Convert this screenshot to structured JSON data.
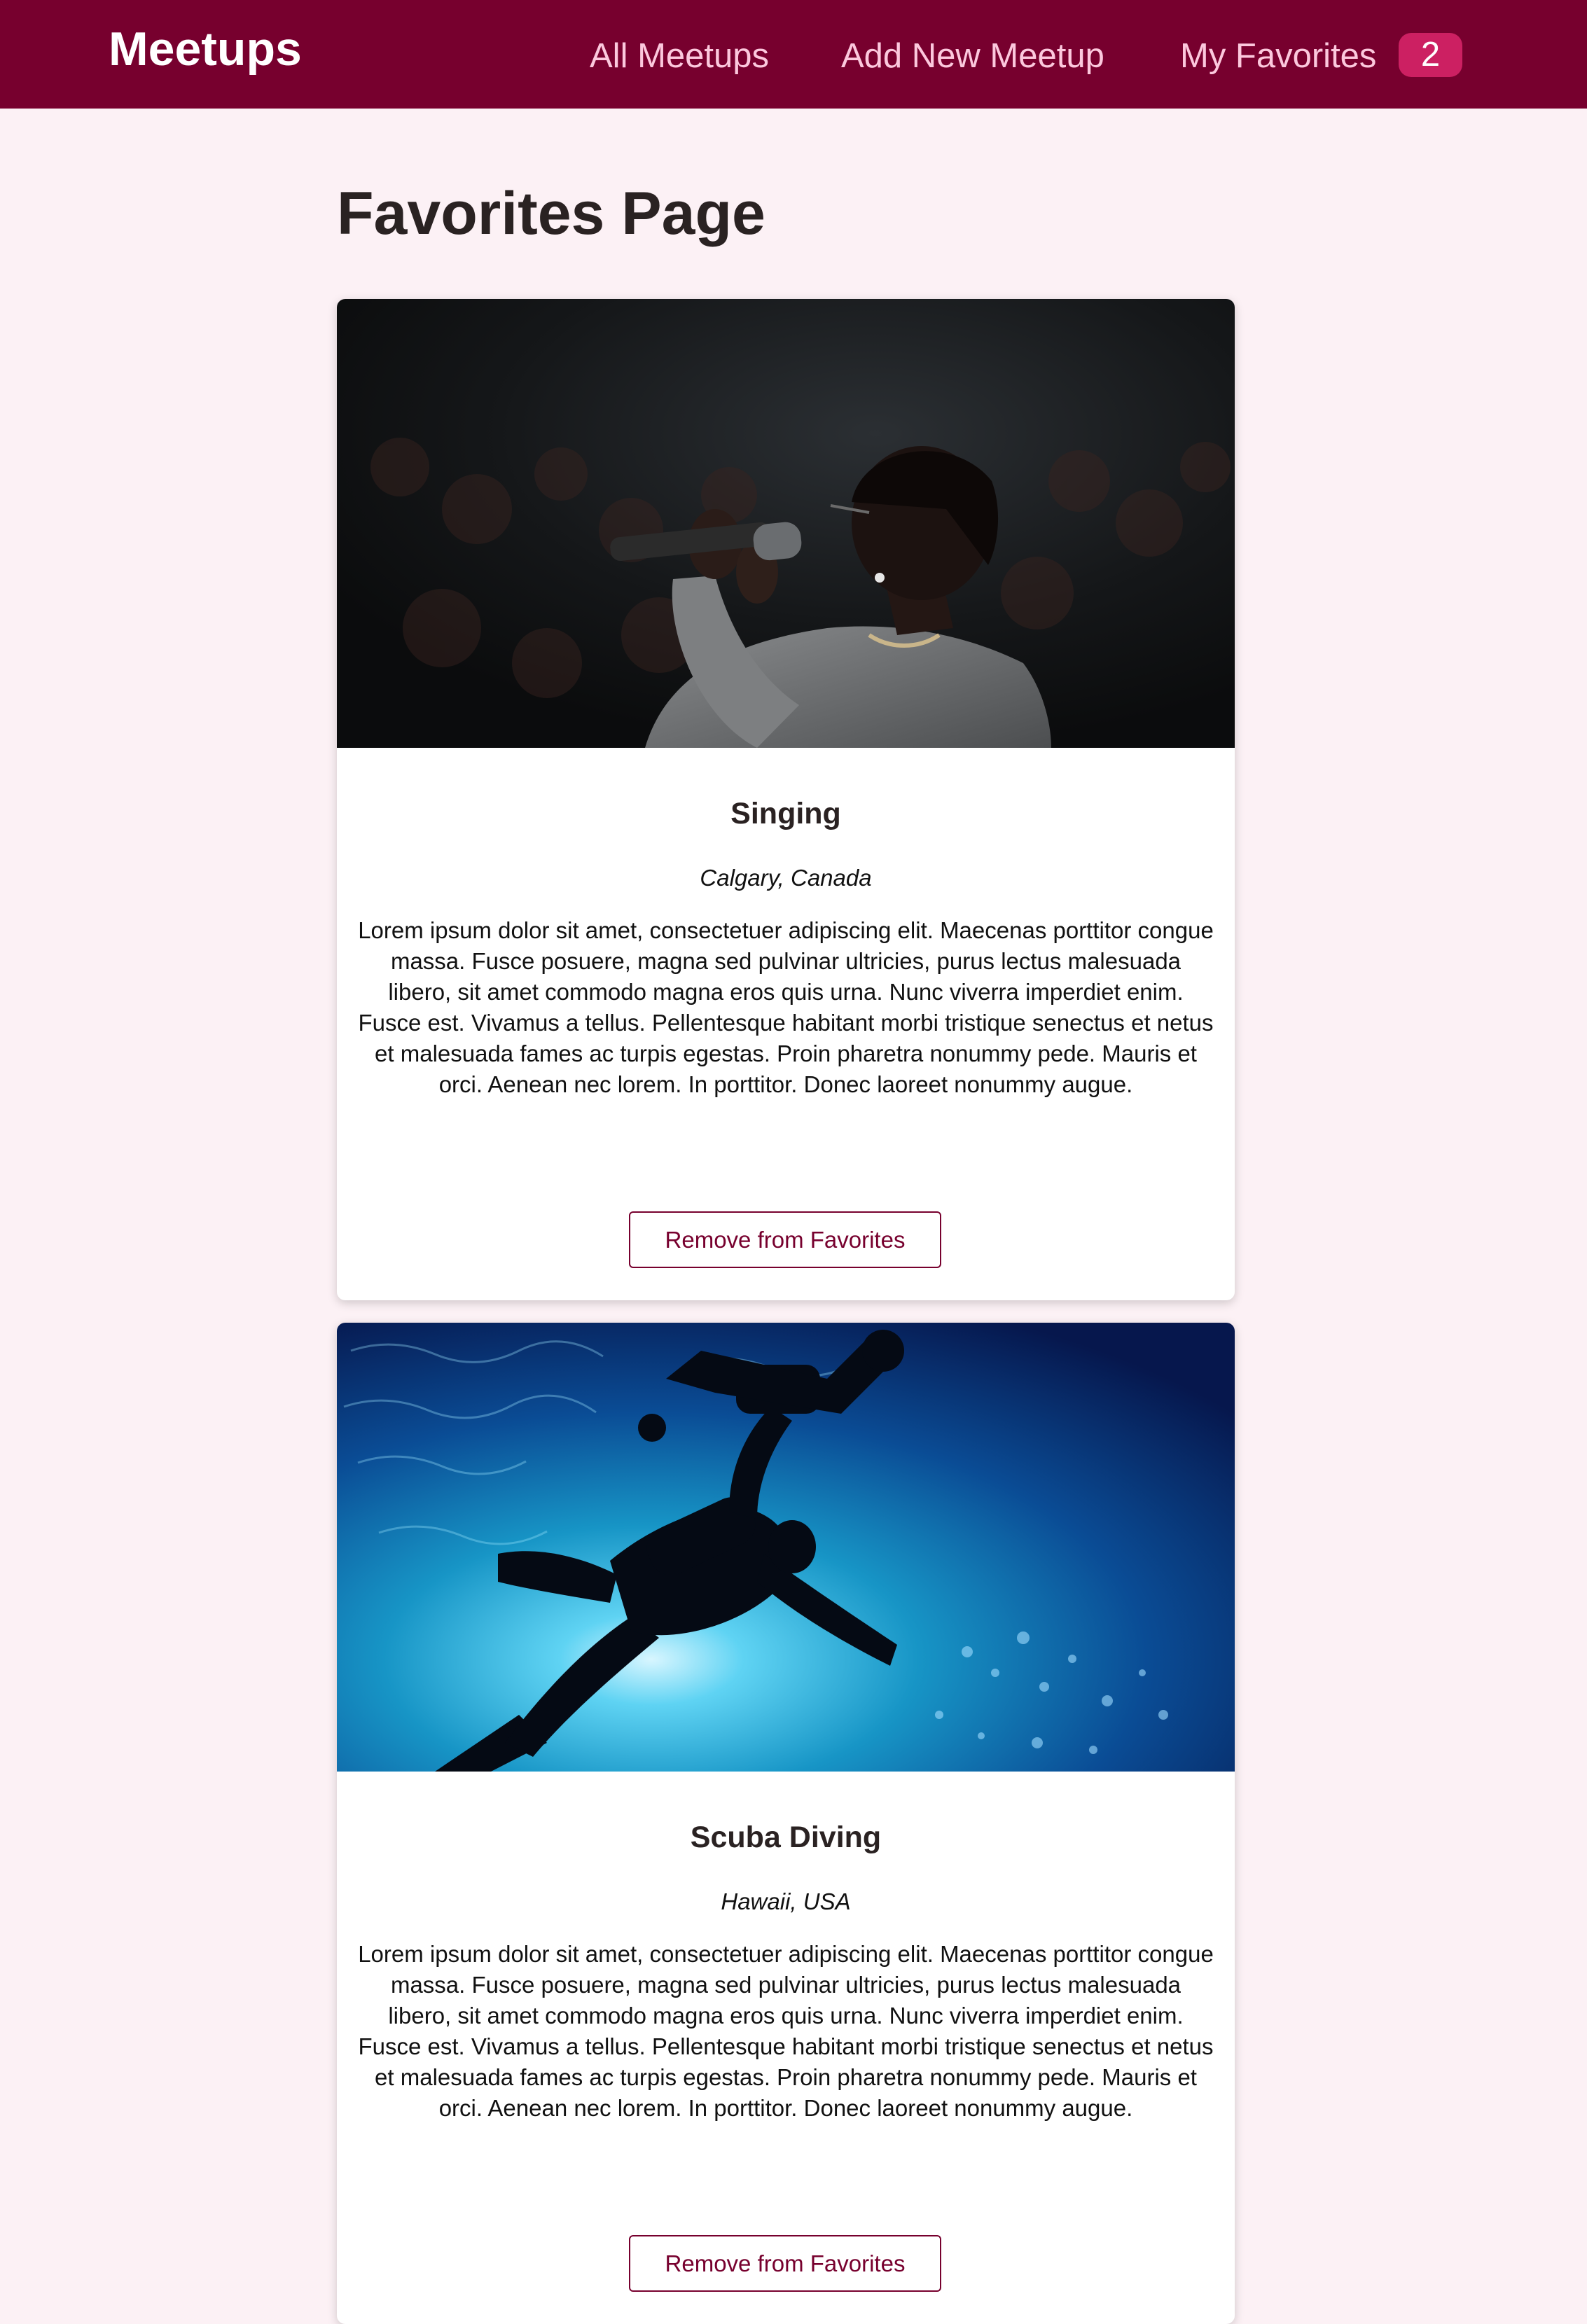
{
  "header": {
    "logo": "Meetups",
    "nav": {
      "all_meetups": "All Meetups",
      "add_new_meetup": "Add New Meetup",
      "my_favorites": "My Favorites",
      "favorites_count": "2"
    }
  },
  "main": {
    "title": "Favorites Page",
    "meetups": [
      {
        "title": "Singing",
        "location": "Calgary, Canada",
        "description": "Lorem ipsum dolor sit amet, consectetuer adipiscing elit. Maecenas porttitor congue massa. Fusce posuere, magna sed pulvinar ultricies, purus lectus malesuada libero, sit amet commodo magna eros quis urna. Nunc viverra imperdiet enim. Fusce est. Vivamus a tellus. Pellentesque habitant morbi tristique senectus et netus et malesuada fames ac turpis egestas. Proin pharetra nonummy pede. Mauris et orci. Aenean nec lorem. In porttitor. Donec laoreet nonummy augue.",
        "button_label": "Remove from Favorites"
      },
      {
        "title": "Scuba Diving",
        "location": "Hawaii, USA",
        "description": "Lorem ipsum dolor sit amet, consectetuer adipiscing elit. Maecenas porttitor congue massa. Fusce posuere, magna sed pulvinar ultricies, purus lectus malesuada libero, sit amet commodo magna eros quis urna. Nunc viverra imperdiet enim. Fusce est. Vivamus a tellus. Pellentesque habitant morbi tristique senectus et netus et malesuada fames ac turpis egestas. Proin pharetra nonummy pede. Mauris et orci. Aenean nec lorem. In porttitor. Donec laoreet nonummy augue.",
        "button_label": "Remove from Favorites"
      }
    ]
  },
  "colors": {
    "header_bg": "#77002e",
    "nav_text": "#fcc8dd",
    "badge_bg": "#cc2062",
    "page_bg": "#fcf1f5",
    "button_accent": "#77002e"
  }
}
